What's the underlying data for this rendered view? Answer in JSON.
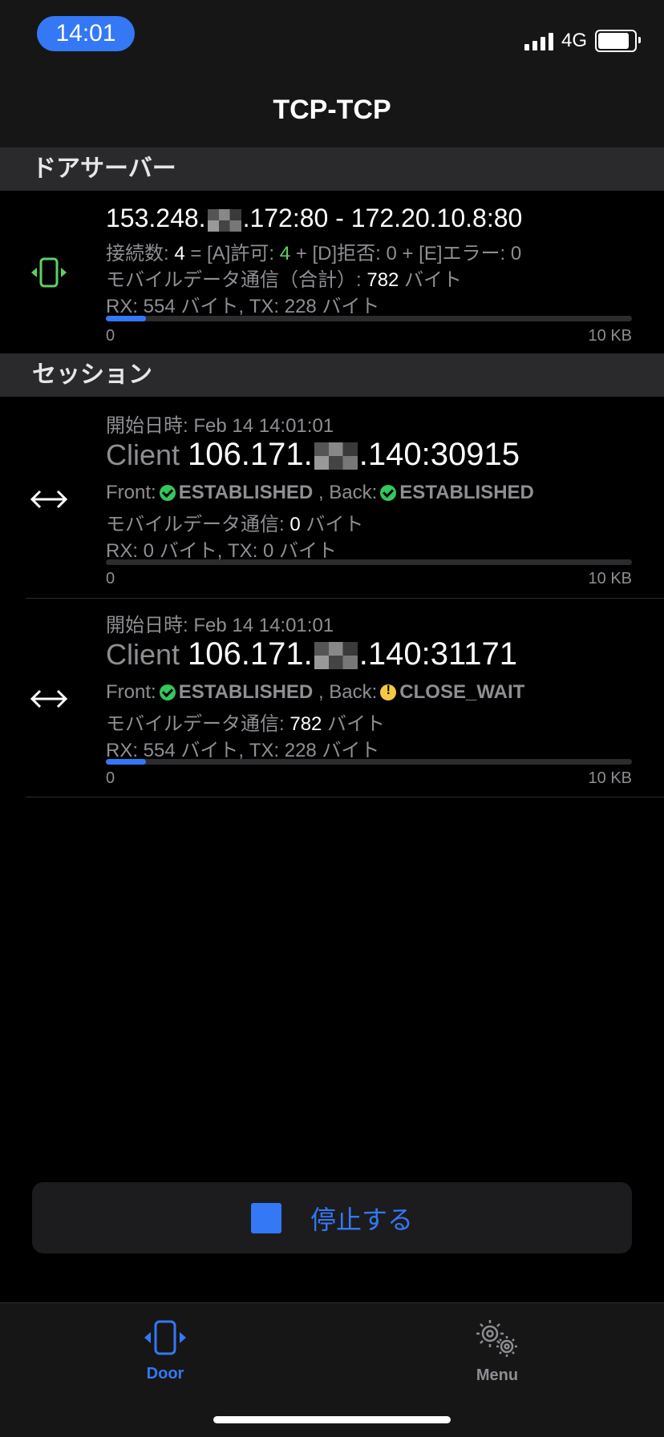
{
  "status_bar": {
    "time": "14:01",
    "network": "4G"
  },
  "nav": {
    "title": "TCP-TCP"
  },
  "door_section": {
    "header": "ドアサーバー",
    "address_pre": "153.248.",
    "address_post": ".172:80 - 172.20.10.8:80",
    "conn_label": "接続数: ",
    "conn_total": "4",
    "conn_eq": " = [A]許可: ",
    "conn_allowed": "4",
    "conn_rest": " + [D]拒否: 0 + [E]エラー: 0",
    "mobile_label": "モバイルデータ通信（合計）: ",
    "mobile_value": "782",
    "mobile_unit": " バイト",
    "rxtx": "RX: 554 バイト, TX: 228 バイト",
    "progress": 0.076,
    "axis_min": "0",
    "axis_max": "10 KB"
  },
  "session_section": {
    "header": "セッション",
    "sessions": [
      {
        "start_label": "開始日時: Feb 14 14:01:01",
        "client_prefix": "Client ",
        "address_pre": "106.171.",
        "address_post": ".140:30915",
        "front_label": "Front:",
        "front_state": "ESTABLISHED",
        "back_label": ", Back:",
        "back_state": "ESTABLISHED",
        "back_status": "ok",
        "mobile_label": "モバイルデータ通信: ",
        "mobile_value": "0",
        "mobile_unit": " バイト",
        "rxtx": "RX: 0 バイト, TX: 0 バイト",
        "progress": 0,
        "axis_min": "0",
        "axis_max": "10 KB"
      },
      {
        "start_label": "開始日時: Feb 14 14:01:01",
        "client_prefix": "Client ",
        "address_pre": "106.171.",
        "address_post": ".140:31171",
        "front_label": "Front:",
        "front_state": "ESTABLISHED",
        "back_label": ", Back:",
        "back_state": "CLOSE_WAIT",
        "back_status": "warning",
        "mobile_label": "モバイルデータ通信: ",
        "mobile_value": "782",
        "mobile_unit": " バイト",
        "rxtx": "RX: 554 バイト, TX: 228 バイト",
        "progress": 0.076,
        "axis_min": "0",
        "axis_max": "10 KB"
      }
    ]
  },
  "stop_button": {
    "label": "停止する"
  },
  "tabs": [
    {
      "label": "Door",
      "icon": "door-icon",
      "active": true,
      "color": "#3478f6"
    },
    {
      "label": "Menu",
      "icon": "gears-icon",
      "active": false,
      "color": "#8e8e93"
    }
  ],
  "colors": {
    "accent": "#3478f6",
    "ok": "#34c759",
    "warning": "#f5c842",
    "door_icon": "#5fd068"
  }
}
